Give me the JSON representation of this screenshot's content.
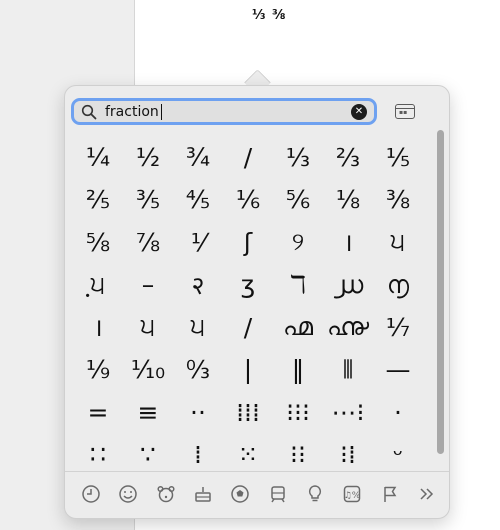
{
  "document": {
    "text": "⅓ ⅜"
  },
  "search": {
    "value": "fraction",
    "clear_glyph": "✕"
  },
  "grid": {
    "rows": [
      [
        "¼",
        "½",
        "¾",
        "/",
        "⅓",
        "⅔",
        "⅕"
      ],
      [
        "⅖",
        "⅗",
        "⅘",
        "⅙",
        "⅚",
        "⅛",
        "⅜"
      ],
      [
        "⅝",
        "⅞",
        "⅟",
        "ʃ",
        "୨",
        "।",
        "੫"
      ],
      [
        "ฺ੫",
        "–",
        "२",
        "ʒ",
        "ℸ",
        "൰",
        "൱"
      ],
      [
        "।",
        "੫",
        "੫",
        "/",
        "൶",
        "൷",
        "⅐"
      ],
      [
        "⅑",
        "⅒",
        "↉",
        "|",
        "‖",
        "⦀",
        "—"
      ],
      [
        "=",
        "≡",
        "··",
        "⁞⁞⁞",
        "⁝⁝⁝",
        "⋯⁝",
        "·"
      ],
      [
        "∷",
        "∵",
        "⁞",
        "⁙",
        "⁝⁝",
        "⁝⁞",
        "ᵕ"
      ]
    ]
  },
  "tabs": [
    {
      "name": "recent",
      "glyph": "◷"
    },
    {
      "name": "smileys",
      "glyph": "☺"
    },
    {
      "name": "animals",
      "glyph": "🐻"
    },
    {
      "name": "food",
      "glyph": "🎂"
    },
    {
      "name": "activity",
      "glyph": "⚽"
    },
    {
      "name": "travel",
      "glyph": "🚆"
    },
    {
      "name": "objects",
      "glyph": "💡"
    },
    {
      "name": "symbols",
      "glyph": "⌘"
    },
    {
      "name": "flags",
      "glyph": "⚐"
    },
    {
      "name": "more",
      "glyph": "»"
    }
  ]
}
